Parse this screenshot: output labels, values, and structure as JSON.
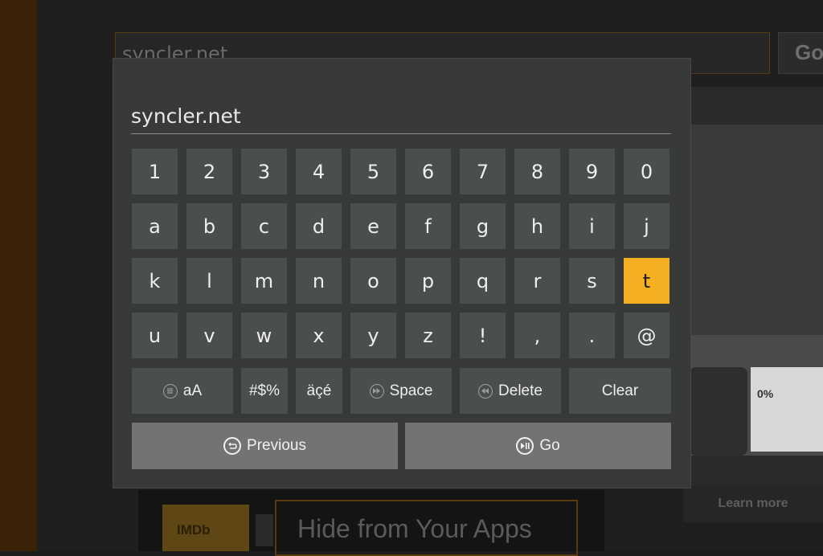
{
  "background": {
    "url_value": "syncler.net",
    "go_label": "Go",
    "learn_more_label": "Learn more",
    "hide_label": "Hide from Your Apps",
    "imdb_logo_text": "IMDb",
    "banner_text": "0%"
  },
  "keyboard": {
    "input_value": "syncler.net",
    "focused_key": "t",
    "rows": [
      [
        "1",
        "2",
        "3",
        "4",
        "5",
        "6",
        "7",
        "8",
        "9",
        "0"
      ],
      [
        "a",
        "b",
        "c",
        "d",
        "e",
        "f",
        "g",
        "h",
        "i",
        "j"
      ],
      [
        "k",
        "l",
        "m",
        "n",
        "o",
        "p",
        "q",
        "r",
        "s",
        "t"
      ],
      [
        "u",
        "v",
        "w",
        "x",
        "y",
        "z",
        "!",
        ",",
        ".",
        "@"
      ]
    ],
    "function_row": {
      "case_toggle": "aA",
      "symbols": "#$%",
      "accents": "äçé",
      "space": "Space",
      "delete": "Delete",
      "clear": "Clear"
    },
    "nav": {
      "previous": "Previous",
      "go": "Go"
    },
    "icons": {
      "menu": "menu-icon",
      "fast-forward": "fast-forward-icon",
      "rewind": "rewind-icon",
      "back": "back-icon",
      "play-pause": "play-pause-icon"
    },
    "colors": {
      "focus": "#f4af23",
      "key": "#4b4e4e",
      "nav_key": "#727474",
      "dialog": "#383a3a"
    }
  }
}
